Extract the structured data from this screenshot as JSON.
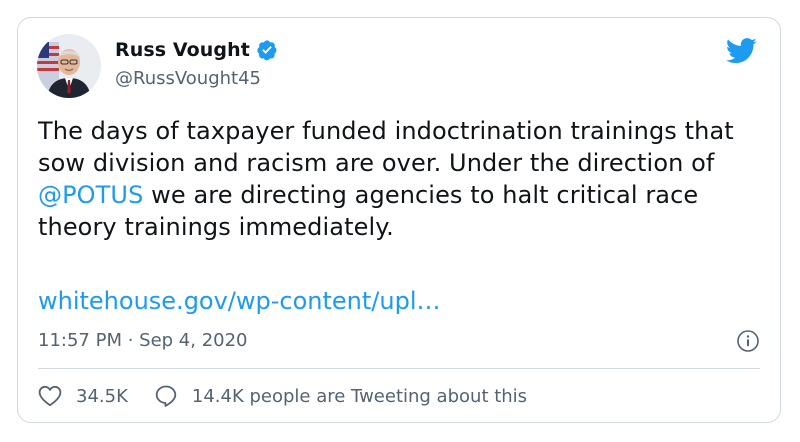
{
  "author": {
    "name": "Russ Vought",
    "handle": "@RussVought45"
  },
  "tweet": {
    "text_before": "The days of taxpayer funded indoctrination trainings that sow division and racism are over. Under the direction of ",
    "mention": "@POTUS",
    "text_after": " we are directing agencies to halt critical race theory trainings immediately.",
    "link": "whitehouse.gov/wp-content/upl…",
    "timestamp": "11:57 PM · Sep 4, 2020"
  },
  "actions": {
    "likes": "34.5K",
    "conversation": "14.4K people are Tweeting about this"
  },
  "colors": {
    "accent": "#1d9bf0",
    "text": "#0f1419",
    "secondary": "#536471",
    "border": "#cfd9de"
  },
  "icons": [
    "verified-badge-icon",
    "twitter-bird-icon",
    "info-icon",
    "heart-icon",
    "speech-bubble-icon"
  ]
}
